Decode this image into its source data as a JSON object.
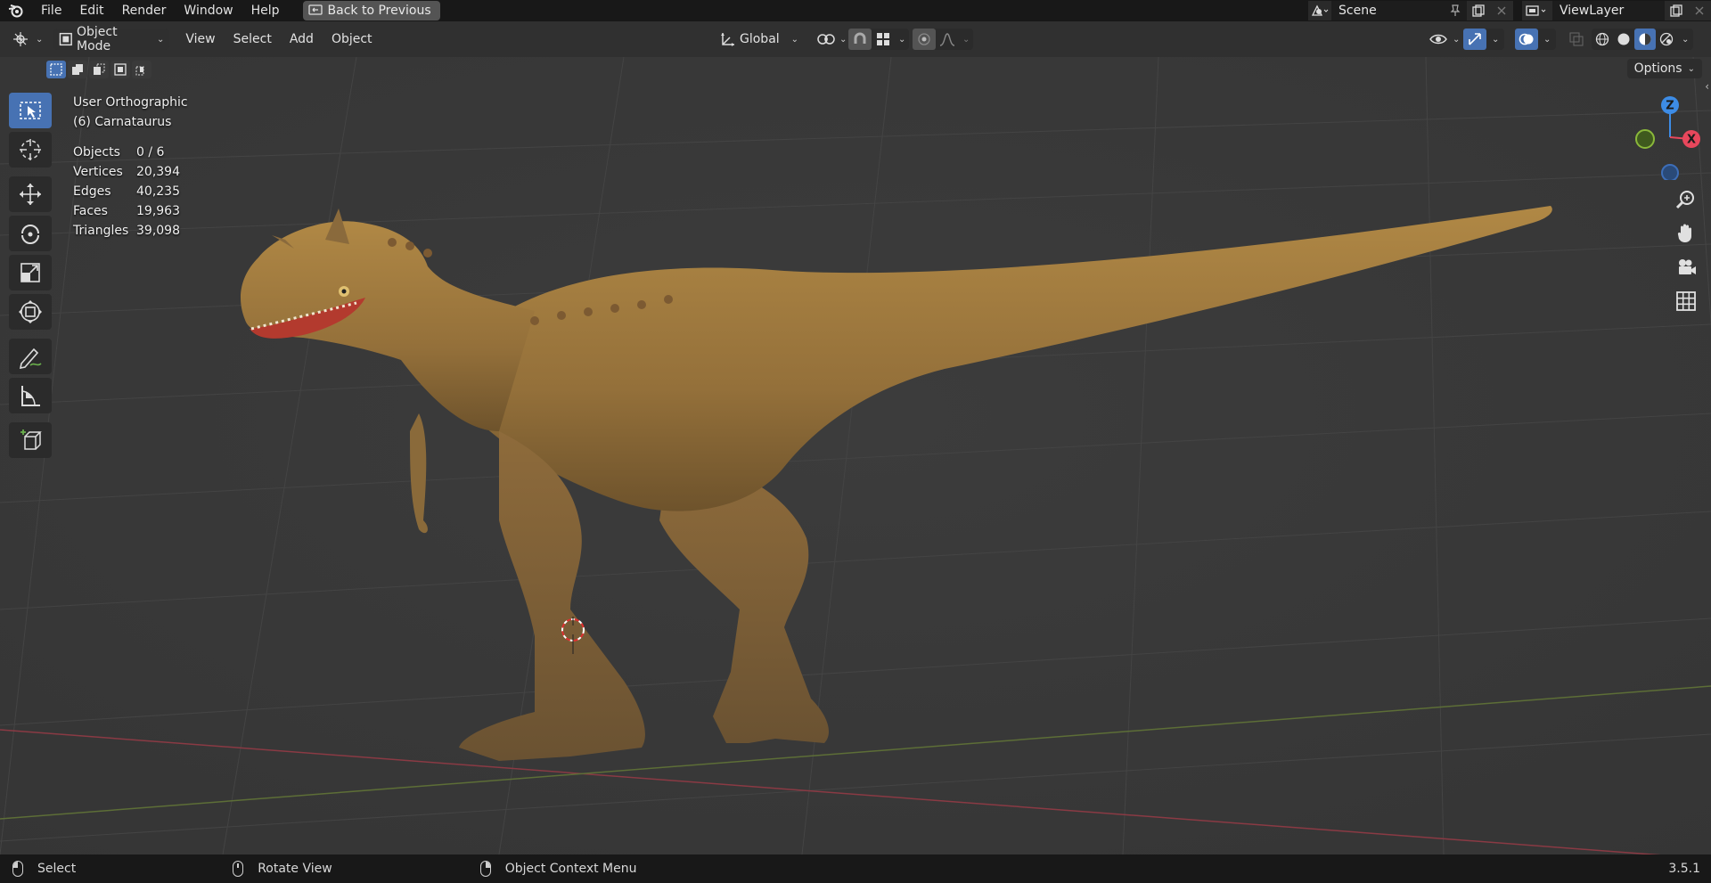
{
  "menu": {
    "items": [
      "File",
      "Edit",
      "Render",
      "Window",
      "Help"
    ],
    "back_label": "Back to Previous"
  },
  "scene": {
    "name": "Scene"
  },
  "view_layer": {
    "name": "ViewLayer"
  },
  "viewport_header": {
    "mode": "Object Mode",
    "menus": [
      "View",
      "Select",
      "Add",
      "Object"
    ],
    "orientation": "Global",
    "options_label": "Options"
  },
  "overlay": {
    "view_name": "User Orthographic",
    "object_name": "(6) Carnataurus",
    "stats": [
      {
        "label": "Objects",
        "value": "0 / 6"
      },
      {
        "label": "Vertices",
        "value": "20,394"
      },
      {
        "label": "Edges",
        "value": "40,235"
      },
      {
        "label": "Faces",
        "value": "19,963"
      },
      {
        "label": "Triangles",
        "value": "39,098"
      }
    ]
  },
  "gizmo": {
    "z": "Z",
    "x": "X"
  },
  "statusbar": {
    "select": "Select",
    "rotate": "Rotate View",
    "context": "Object Context Menu",
    "version": "3.5.1"
  },
  "colors": {
    "accent": "#4772b3",
    "axis_x": "#e8475c",
    "axis_y": "#8ab83a",
    "axis_z": "#3d8ce6",
    "model": "#9c7438"
  }
}
